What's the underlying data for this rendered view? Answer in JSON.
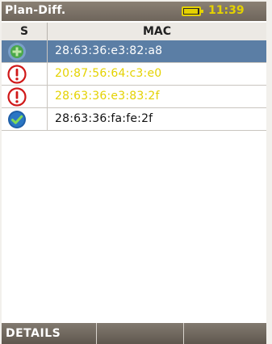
{
  "header": {
    "title": "Plan-Diff.",
    "time": "11:39",
    "battery_icon": "battery-icon",
    "accent_color": "#e4d200"
  },
  "table": {
    "columns": [
      "S",
      "MAC"
    ],
    "rows": [
      {
        "status": "added",
        "status_icon": "plus-circle-icon",
        "mac": "28:63:36:e3:82:a8",
        "mac_color": "#ffffff",
        "selected": true
      },
      {
        "status": "warning",
        "status_icon": "exclamation-circle-icon",
        "mac": "20:87:56:64:c3:e0",
        "mac_color": "#e4d200",
        "selected": false
      },
      {
        "status": "warning",
        "status_icon": "exclamation-circle-icon",
        "mac": "28:63:36:e3:83:2f",
        "mac_color": "#e4d200",
        "selected": false
      },
      {
        "status": "ok",
        "status_icon": "check-circle-icon",
        "mac": "28:63:36:fa:fe:2f",
        "mac_color": "#111111",
        "selected": false
      }
    ]
  },
  "footer": {
    "softkeys": [
      "DETAILS",
      "",
      ""
    ]
  }
}
